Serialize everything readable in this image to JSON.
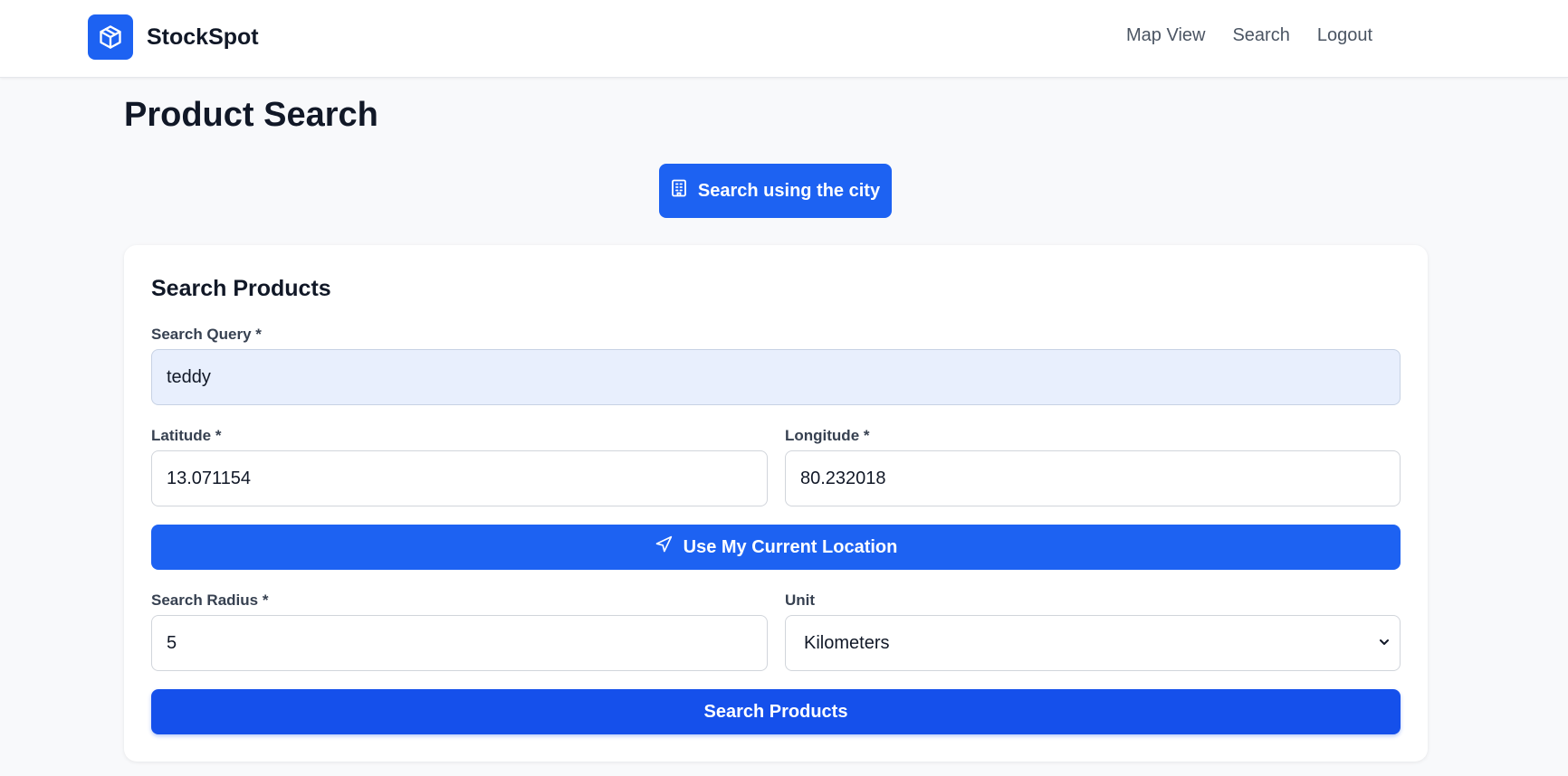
{
  "app": {
    "name": "StockSpot",
    "logo_icon": "package-icon",
    "brand_color": "#1d62f2"
  },
  "nav": {
    "items": [
      {
        "label": "Map View"
      },
      {
        "label": "Search"
      },
      {
        "label": "Logout"
      }
    ]
  },
  "page": {
    "title": "Product Search"
  },
  "city_search": {
    "label": "Search using the city",
    "icon": "building-icon"
  },
  "form": {
    "title": "Search Products",
    "query": {
      "label": "Search Query *",
      "value": "teddy"
    },
    "latitude": {
      "label": "Latitude *",
      "value": "13.071154"
    },
    "longitude": {
      "label": "Longitude *",
      "value": "80.232018"
    },
    "location_button": {
      "label": "Use My Current Location",
      "icon": "navigation-arrow-icon"
    },
    "radius": {
      "label": "Search Radius *",
      "value": "5"
    },
    "unit": {
      "label": "Unit",
      "value": "Kilometers"
    },
    "submit_label": "Search Products"
  }
}
